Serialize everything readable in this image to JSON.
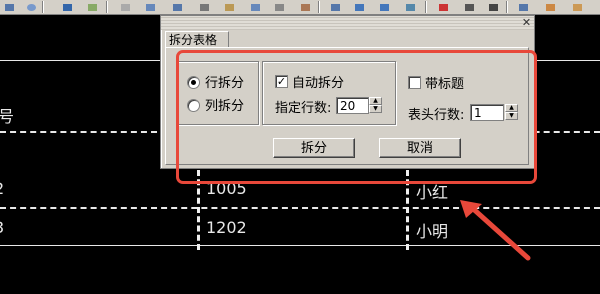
{
  "toolbar": {
    "buttons": [
      "save-icon",
      "zoom-icon",
      "grid-icon",
      "image-icon",
      "select-icon",
      "insert-icon",
      "table-icon",
      "text-icon",
      "paste-icon",
      "edit-icon",
      "cut-icon",
      "attribute-icon",
      "calc-icon",
      "up-icon",
      "down-icon",
      "chart-icon",
      "flag-icon",
      "tool-icon",
      "arrow-icon",
      "window-icon",
      "palette-icon",
      "bag-icon"
    ]
  },
  "cad_table": {
    "header_partial": "号",
    "rows": [
      {
        "index": "2",
        "number": "1005",
        "name": "小红"
      },
      {
        "index": "3",
        "number": "1202",
        "name": "小明"
      }
    ]
  },
  "dialog": {
    "close_glyph": "✕",
    "tab_label": "拆分表格",
    "split_mode": {
      "options": [
        "行拆分",
        "列拆分"
      ],
      "selected": "行拆分"
    },
    "auto_split": {
      "label": "自动拆分",
      "checked": true
    },
    "rows_per_table": {
      "label": "指定行数:",
      "value": "20"
    },
    "with_title": {
      "label": "带标题",
      "checked": false
    },
    "header_rows": {
      "label": "表头行数:",
      "value": "1"
    },
    "ok_button": "拆分",
    "cancel_button": "取消",
    "spin_up": "▲",
    "spin_down": "▼"
  },
  "colors": {
    "highlight": "#e8483a",
    "dialog_bg": "#d4d0c8",
    "canvas_bg": "#000000"
  }
}
